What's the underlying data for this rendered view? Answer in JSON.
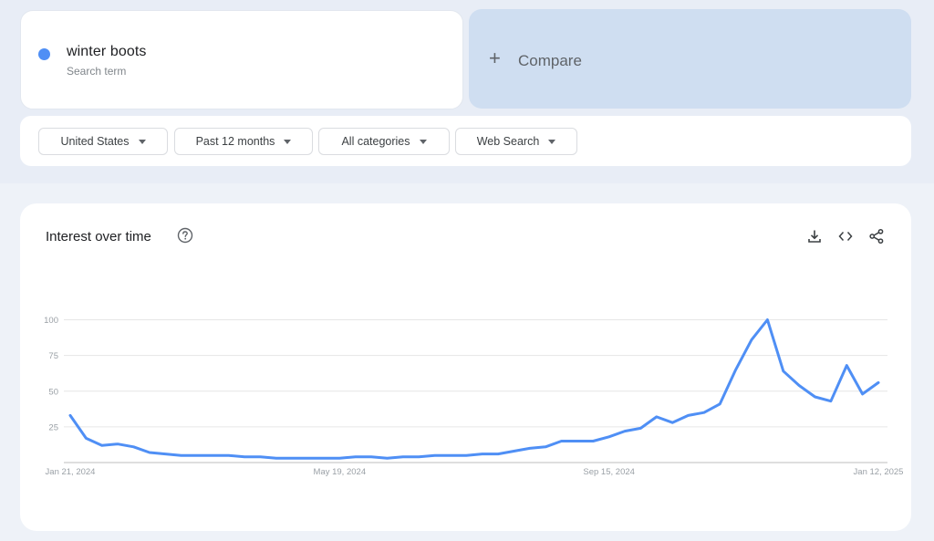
{
  "search_term": {
    "name": "winter boots",
    "subtitle": "Search term",
    "color": "#4f8ff5"
  },
  "compare": {
    "icon": "plus-icon",
    "label": "Compare"
  },
  "filters": [
    {
      "label": "United States",
      "icon": "caret-down-icon"
    },
    {
      "label": "Past 12 months",
      "icon": "caret-down-icon"
    },
    {
      "label": "All categories",
      "icon": "caret-down-icon"
    },
    {
      "label": "Web Search",
      "icon": "caret-down-icon"
    }
  ],
  "interest_panel": {
    "title": "Interest over time",
    "help_icon": "help-circle-icon",
    "actions": [
      {
        "name": "download",
        "icon": "download-icon"
      },
      {
        "name": "embed",
        "icon": "code-icon"
      },
      {
        "name": "share",
        "icon": "share-icon"
      }
    ]
  },
  "chart_data": {
    "type": "line",
    "title": "Interest over time",
    "xlabel": "",
    "ylabel": "",
    "ylim": [
      0,
      100
    ],
    "y_ticks": [
      25,
      50,
      75,
      100
    ],
    "x_tick_labels": [
      {
        "index": 0,
        "label": "Jan 21, 2024"
      },
      {
        "index": 17,
        "label": "May 19, 2024"
      },
      {
        "index": 34,
        "label": "Sep 15, 2024"
      },
      {
        "index": 51,
        "label": "Jan 12, 2025"
      }
    ],
    "x_start": "Jan 21, 2024",
    "x_end": "Jan 12, 2025",
    "x_interval": "weekly",
    "grid": true,
    "series": [
      {
        "name": "winter boots",
        "color": "#4f8ff5",
        "values": [
          33,
          17,
          12,
          13,
          11,
          7,
          6,
          5,
          5,
          5,
          5,
          4,
          4,
          3,
          3,
          3,
          3,
          3,
          4,
          4,
          3,
          4,
          4,
          5,
          5,
          5,
          6,
          6,
          8,
          10,
          11,
          15,
          15,
          15,
          18,
          22,
          24,
          32,
          28,
          33,
          35,
          41,
          65,
          86,
          100,
          64,
          54,
          46,
          43,
          68,
          48,
          56
        ]
      }
    ]
  }
}
